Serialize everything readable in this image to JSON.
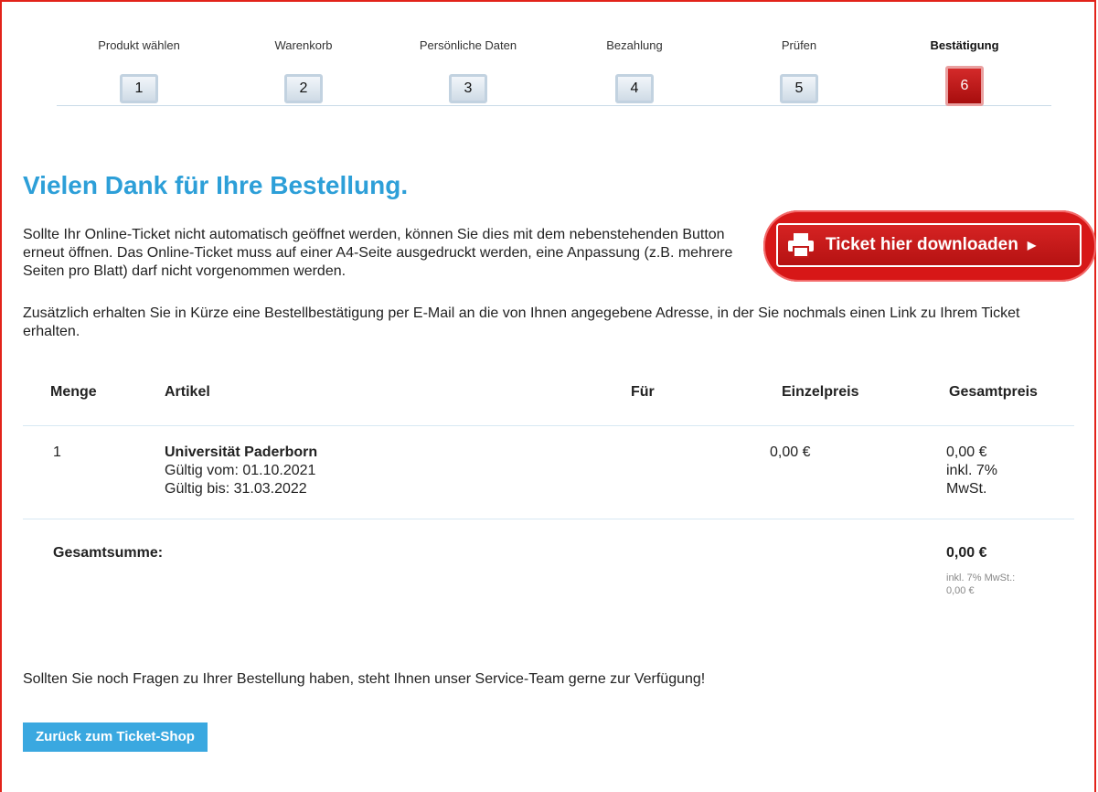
{
  "steps": [
    {
      "label": "Produkt wählen",
      "number": "1"
    },
    {
      "label": "Warenkorb",
      "number": "2"
    },
    {
      "label": "Persönliche Daten",
      "number": "3"
    },
    {
      "label": "Bezahlung",
      "number": "4"
    },
    {
      "label": "Prüfen",
      "number": "5"
    },
    {
      "label": "Bestätigung",
      "number": "6"
    }
  ],
  "active_step": 6,
  "colors": {
    "accent_blue": "#2d9fd8",
    "accent_red": "#c41a1a"
  },
  "heading": "Vielen Dank für Ihre Bestellung.",
  "intro_text": "Sollte Ihr Online-Ticket nicht automatisch geöffnet werden, können Sie dies mit dem nebenstehenden Button erneut öffnen. Das Online-Ticket muss auf einer A4-Seite ausgedruckt werden, eine Anpassung (z.B. mehrere Seiten pro Blatt) darf nicht vorgenommen werden.",
  "download_button": {
    "label": "Ticket hier downloaden",
    "icon": "printer-icon"
  },
  "email_text": "Zusätzlich erhalten Sie in Kürze eine Bestellbestätigung per E-Mail an die von Ihnen angegebene Adresse, in der Sie nochmals einen Link zu Ihrem Ticket erhalten.",
  "table": {
    "headers": {
      "menge": "Menge",
      "artikel": "Artikel",
      "fuer": "Für",
      "einzelpreis": "Einzelpreis",
      "gesamtpreis": "Gesamtpreis"
    },
    "row": {
      "menge": "1",
      "artikel_title": "Universität Paderborn",
      "valid_from": "Gültig vom: 01.10.2021",
      "valid_to": "Gültig bis: 31.03.2022",
      "fuer": "",
      "einzelpreis": "0,00 €",
      "gesamtpreis_1": "0,00 €",
      "gesamtpreis_2": "inkl. 7%",
      "gesamtpreis_3": "MwSt."
    },
    "total_label": "Gesamtsumme:",
    "total_value": "0,00 €",
    "total_note_1": "inkl. 7% MwSt.:",
    "total_note_2": "0,00 €"
  },
  "service_text": "Sollten Sie noch Fragen zu Ihrer Bestellung haben, steht Ihnen unser Service-Team gerne zur Verfügung!",
  "back_button": "Zurück zum Ticket-Shop"
}
